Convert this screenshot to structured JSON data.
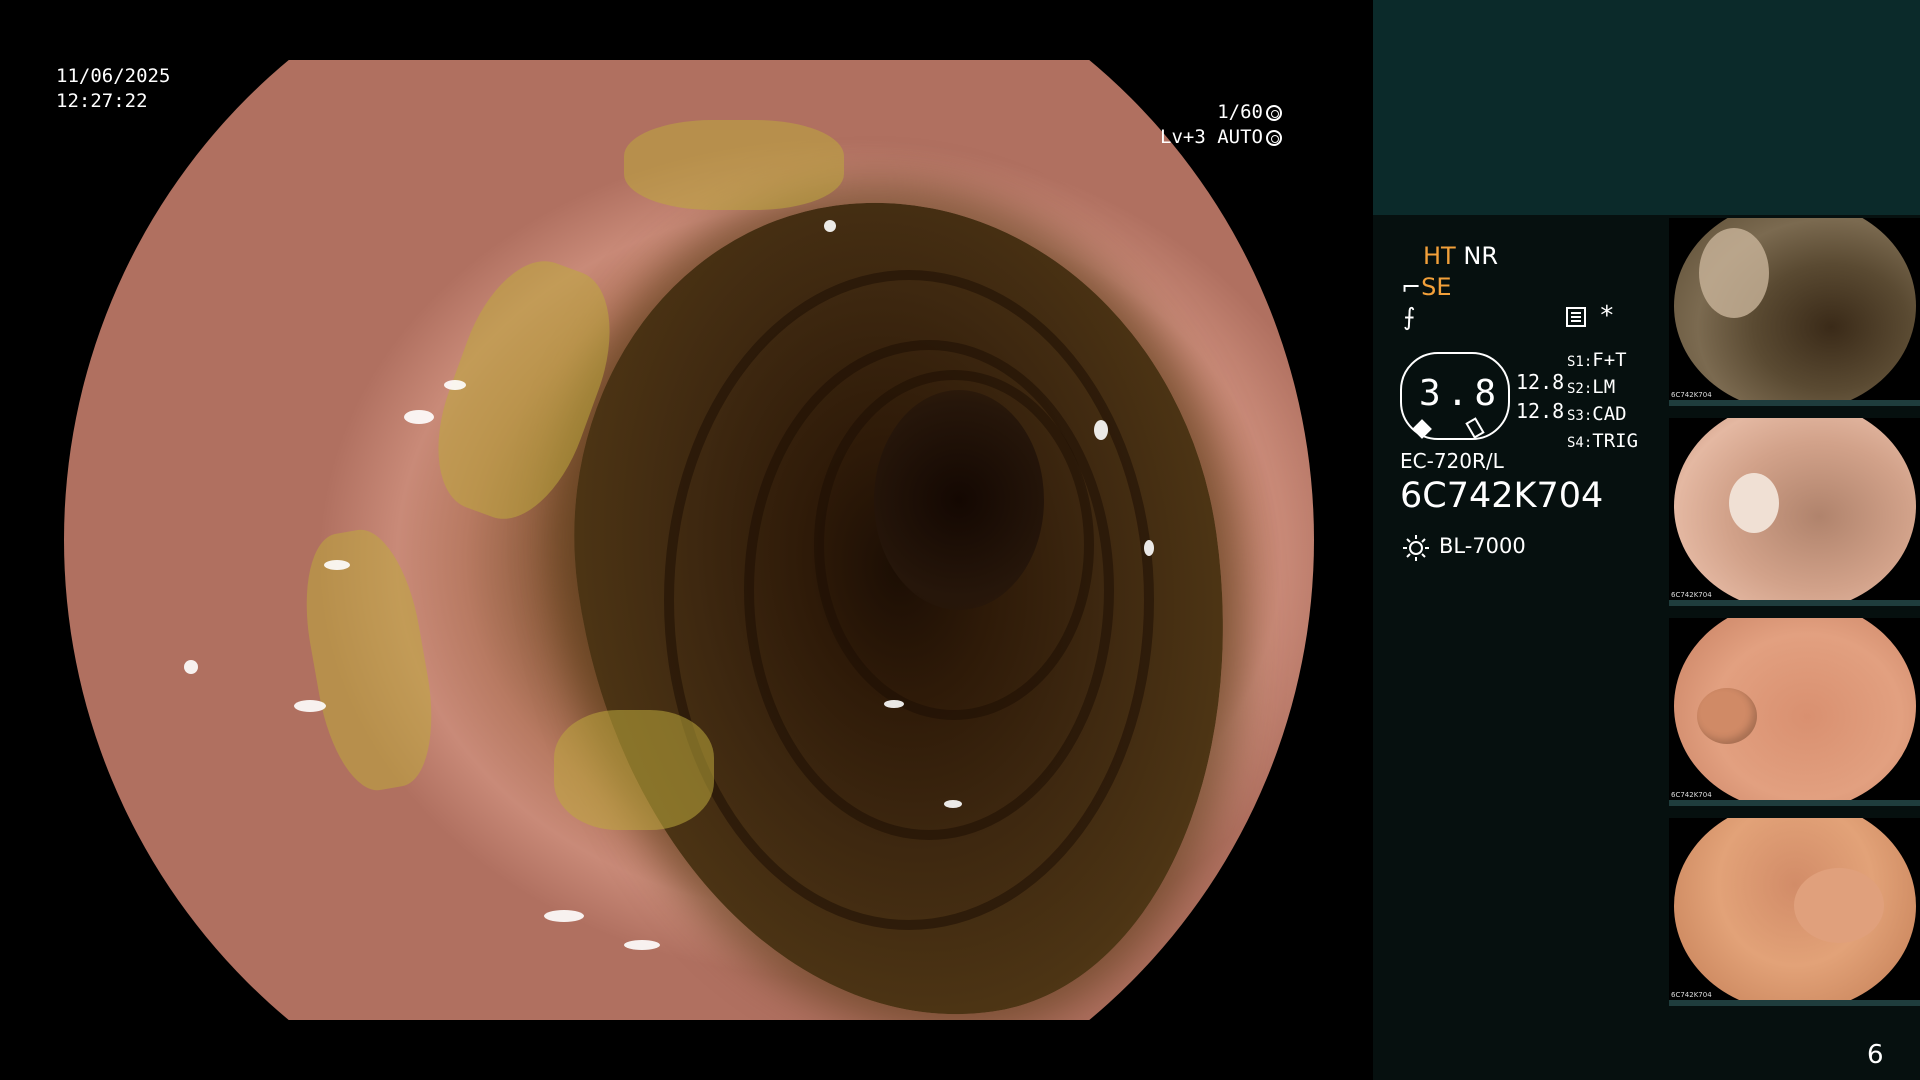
{
  "overlay": {
    "date": "11/06/2025",
    "time": "12:27:22",
    "shutter": "1/60",
    "level_mode": "Lv+3 AUTO"
  },
  "panel": {
    "mode_ht": "HT",
    "mode_nr": "NR",
    "mode_se": "SE",
    "f_symbol": "⨍",
    "star": "*",
    "zoom_value": "3.8",
    "num_1": "12.8",
    "num_2": "12.8",
    "switches": [
      {
        "key": "S1:",
        "value": "F+T"
      },
      {
        "key": "S2:",
        "value": "LM"
      },
      {
        "key": "S3:",
        "value": "CAD"
      },
      {
        "key": "S4:",
        "value": "TRIG"
      }
    ],
    "scope_model": "EC-720R/L",
    "serial": "6C742K704",
    "light_source": "BL-7000",
    "page_number": "6"
  },
  "thumbnails": [
    {
      "caption": "6C742K704"
    },
    {
      "caption": "6C742K704"
    },
    {
      "caption": "6C742K704"
    },
    {
      "caption": "6C742K704"
    }
  ],
  "colors": {
    "accent_orange": "#f2a03a",
    "panel_top": "#0b2a2a",
    "panel_bg": "#06100f"
  }
}
